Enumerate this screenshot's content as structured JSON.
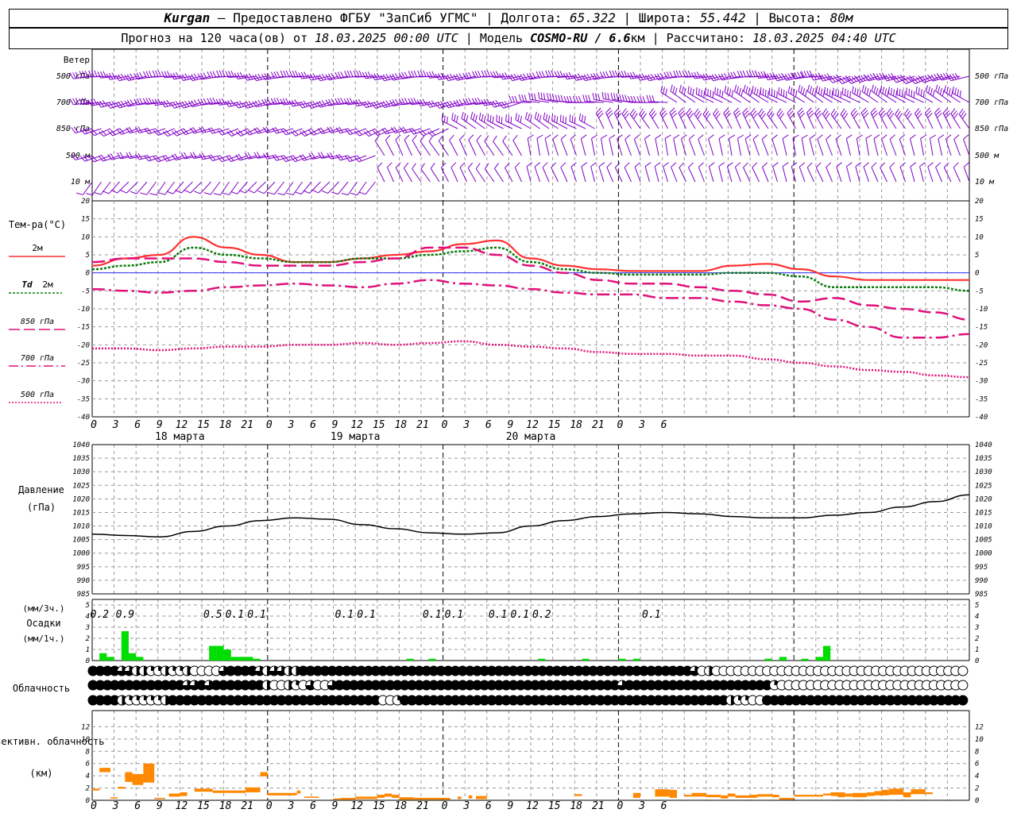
{
  "header": {
    "station": "Kurgan",
    "provider": " – Предоставлено ФГБУ \"ЗапСиб УГМС\" | Долгота: ",
    "lon": "65.322",
    "lat_label": " | Широта: ",
    "lat": "55.442",
    "alt_label": " | Высота: ",
    "alt": "80м",
    "fc_label": "Прогноз на 120 часа(ов) от ",
    "fc_time": "18.03.2025 00:00 UTC",
    "model_label": " | Модель ",
    "model": "COSMO-RU / 6.6",
    "model_unit": "км",
    "calc_label": " | Рассчитано: ",
    "calc_time": "18.03.2025 04:40 UTC"
  },
  "colors": {
    "wind": "#8000c8",
    "t2m": "#ff3030",
    "td2m": "#0a7a0a",
    "t850": "#e0107a",
    "t700": "#e0107a",
    "t500": "#e0107a",
    "zero": "#3030ff",
    "precip3": "#00dd00",
    "precip1": "#0000ff",
    "conv": "#ff8800",
    "grid": "#999999"
  },
  "time_axis": {
    "ticks": [
      "0",
      "3",
      "6",
      "9",
      "12",
      "15",
      "18",
      "21",
      "0",
      "3",
      "6",
      "9",
      "12",
      "15",
      "18",
      "21",
      "0",
      "3",
      "6",
      "9",
      "12",
      "15",
      "18",
      "21",
      "0",
      "3",
      "6"
    ],
    "days": [
      "18 марта",
      "19 марта",
      "20 марта"
    ]
  },
  "wind_panel": {
    "title": "Ветер",
    "levels": [
      "500 гПа",
      "700 гПа",
      "850 гПа",
      "500 м",
      "10 м"
    ]
  },
  "chart_data": [
    {
      "type": "line",
      "title": "Тем-ра(°C)",
      "ylim": [
        -40,
        20
      ],
      "yticks": [
        20,
        15,
        10,
        5,
        0,
        -5,
        -10,
        -15,
        -20,
        -25,
        -30,
        -35,
        -40
      ],
      "x_hours": [
        0,
        3,
        6,
        9,
        12,
        15,
        18,
        21,
        24,
        27,
        30,
        33,
        36,
        39,
        42,
        45,
        48,
        51,
        54,
        57,
        60,
        63,
        66,
        69,
        72,
        75,
        78
      ],
      "series": [
        {
          "name": "2м",
          "values": [
            2,
            4,
            5,
            10,
            7,
            5,
            3,
            3,
            4,
            5,
            6,
            8,
            9,
            4,
            2,
            1,
            0.5,
            0.5,
            0.5,
            2,
            2.5,
            1,
            -1,
            -2,
            -2,
            -2,
            -2
          ]
        },
        {
          "name": "Td 2м",
          "values": [
            1,
            2,
            3,
            7,
            5,
            4,
            3,
            3,
            4,
            4,
            5,
            6,
            7,
            3,
            1,
            0,
            -0.5,
            -0.5,
            -0.5,
            0,
            0,
            -1,
            -4,
            -4,
            -4,
            -4,
            -5
          ]
        },
        {
          "name": "850 гПа",
          "values": [
            3,
            4,
            4,
            4,
            3,
            2,
            2,
            2,
            3,
            4,
            7,
            7,
            5,
            2,
            0,
            -2,
            -3,
            -3,
            -4,
            -5,
            -6,
            -8,
            -7,
            -9,
            -10,
            -11,
            -13
          ]
        },
        {
          "name": "700 гПа",
          "values": [
            -4.5,
            -5,
            -5.5,
            -5,
            -4,
            -3.5,
            -3,
            -3.5,
            -4,
            -3,
            -2,
            -3,
            -3.5,
            -4.5,
            -5.5,
            -6,
            -6,
            -7,
            -7,
            -8,
            -9,
            -10,
            -13,
            -15,
            -18,
            -18,
            -17
          ]
        },
        {
          "name": "500 гПа",
          "values": [
            -21,
            -21,
            -21.5,
            -21,
            -20.5,
            -20.5,
            -20,
            -20,
            -19.5,
            -20,
            -19.5,
            -19,
            -20,
            -20.5,
            -21,
            -22,
            -22.5,
            -22.5,
            -23,
            -23,
            -24,
            -25,
            -26,
            -27,
            -27.5,
            -28.5,
            -29
          ]
        }
      ]
    },
    {
      "type": "line",
      "title": "Давление",
      "unit": "(гПа)",
      "ylim": [
        985,
        1040
      ],
      "yticks": [
        1040,
        1035,
        1030,
        1025,
        1020,
        1015,
        1010,
        1005,
        1000,
        995,
        990,
        985
      ],
      "x_hours": [
        0,
        3,
        6,
        9,
        12,
        15,
        18,
        21,
        24,
        27,
        30,
        33,
        36,
        39,
        42,
        45,
        48,
        51,
        54,
        57,
        60,
        63,
        66,
        69,
        72,
        75,
        78
      ],
      "values": [
        1007,
        1006.5,
        1006,
        1008,
        1010,
        1012,
        1013,
        1012.5,
        1010.5,
        1009,
        1007.5,
        1007,
        1007.5,
        1010,
        1012,
        1013.5,
        1014.5,
        1015,
        1014.5,
        1013.5,
        1013,
        1013,
        1014,
        1015,
        1017,
        1019,
        1021.5
      ]
    },
    {
      "type": "bar",
      "title": "Осадки",
      "units": [
        "(мм/3ч.)",
        "(мм/1ч.)"
      ],
      "ylim": [
        0,
        5
      ],
      "yticks": [
        5,
        4,
        3,
        2,
        1,
        0
      ],
      "hourly_mm": [
        0,
        0.2,
        0.1,
        0,
        0.8,
        0.2,
        0.1,
        0,
        0,
        0,
        0,
        0,
        0,
        0,
        0,
        0,
        0.4,
        0.4,
        0.3,
        0.1,
        0.1,
        0.1,
        0.05,
        0,
        0,
        0,
        0,
        0,
        0,
        0,
        0,
        0,
        0,
        0,
        0,
        0,
        0,
        0,
        0,
        0,
        0,
        0,
        0,
        0.05,
        0,
        0,
        0.05,
        0,
        0,
        0,
        0,
        0,
        0,
        0,
        0,
        0,
        0,
        0,
        0,
        0,
        0,
        0.05,
        0,
        0,
        0,
        0,
        0,
        0.05,
        0,
        0,
        0,
        0,
        0.05,
        0,
        0.05,
        0,
        0,
        0,
        0,
        0,
        0,
        0,
        0,
        0,
        0,
        0,
        0,
        0,
        0,
        0,
        0,
        0,
        0.05,
        0,
        0.1,
        0,
        0,
        0.05,
        0,
        0.1,
        0.4,
        0,
        0,
        0,
        0,
        0,
        0,
        0,
        0,
        0,
        0,
        0,
        0,
        0,
        0,
        0,
        0,
        0,
        0
      ],
      "labels": [
        {
          "h": 1,
          "text": "0.2"
        },
        {
          "h": 4.5,
          "text": "0.9"
        },
        {
          "h": 16.5,
          "text": "0.5"
        },
        {
          "h": 19.5,
          "text": "0.1"
        },
        {
          "h": 22.5,
          "text": "0.1"
        },
        {
          "h": 34.5,
          "text": "0.1"
        },
        {
          "h": 37.5,
          "text": "0.1"
        },
        {
          "h": 46.5,
          "text": "0.1"
        },
        {
          "h": 49.5,
          "text": "0.1"
        },
        {
          "h": 55.5,
          "text": "0.1"
        },
        {
          "h": 58.5,
          "text": "0.1"
        },
        {
          "h": 61.5,
          "text": "0.2"
        },
        {
          "h": 76.5,
          "text": "0.1"
        }
      ]
    },
    {
      "type": "table",
      "title": "Облачность",
      "rows_note": "high / middle / low cloud cover, octas per hour",
      "high": [
        8,
        8,
        8,
        8,
        6,
        6,
        4,
        4,
        2,
        2,
        4,
        2,
        2,
        4,
        0,
        0,
        0,
        0,
        6,
        8,
        8,
        8,
        8,
        6,
        4,
        6,
        6,
        4,
        4,
        8,
        8,
        8,
        8,
        8,
        8,
        8,
        8,
        8,
        8,
        8,
        8,
        8,
        8,
        8,
        8,
        8,
        8,
        8,
        8,
        8,
        8,
        8,
        8,
        8,
        8,
        8,
        8,
        8,
        8,
        8,
        8,
        8,
        8,
        8,
        8,
        8,
        8,
        8,
        8,
        8,
        8,
        8,
        8,
        8,
        8,
        8,
        8,
        8,
        8,
        8,
        8,
        8,
        8,
        6,
        0,
        4,
        0,
        0,
        0,
        0,
        0,
        0,
        0,
        0,
        0,
        0,
        0,
        0,
        0,
        0,
        0,
        0,
        0,
        0,
        0,
        0,
        0,
        0,
        0,
        0,
        0,
        0,
        0,
        0,
        0,
        0,
        0,
        0,
        0,
        0,
        0
      ],
      "middle": [
        8,
        8,
        8,
        8,
        8,
        8,
        8,
        8,
        8,
        8,
        8,
        8,
        8,
        6,
        6,
        8,
        6,
        8,
        8,
        8,
        8,
        8,
        8,
        8,
        4,
        0,
        0,
        4,
        2,
        0,
        6,
        0,
        0,
        6,
        8,
        8,
        8,
        8,
        8,
        8,
        8,
        8,
        8,
        8,
        8,
        8,
        8,
        8,
        8,
        8,
        8,
        8,
        8,
        8,
        8,
        8,
        8,
        8,
        8,
        8,
        8,
        8,
        8,
        8,
        8,
        8,
        8,
        8,
        8,
        8,
        8,
        8,
        8,
        6,
        8,
        8,
        8,
        8,
        8,
        8,
        8,
        8,
        8,
        8,
        8,
        8,
        8,
        8,
        8,
        8,
        8,
        8,
        8,
        8,
        2,
        0,
        0,
        0,
        0,
        0,
        0,
        0,
        0,
        0,
        0,
        0,
        0,
        0,
        0,
        0,
        0,
        0,
        0,
        0,
        0,
        0,
        0,
        0,
        0,
        0,
        0
      ],
      "low": [
        8,
        8,
        8,
        8,
        4,
        2,
        2,
        2,
        2,
        2,
        4,
        8,
        8,
        8,
        8,
        8,
        8,
        8,
        8,
        8,
        8,
        8,
        8,
        8,
        8,
        8,
        8,
        8,
        8,
        8,
        8,
        8,
        8,
        8,
        8,
        8,
        8,
        8,
        8,
        8,
        0,
        0,
        2,
        8,
        8,
        8,
        8,
        8,
        8,
        8,
        8,
        8,
        8,
        8,
        8,
        8,
        8,
        8,
        8,
        8,
        8,
        8,
        8,
        8,
        8,
        8,
        8,
        8,
        8,
        8,
        8,
        8,
        8,
        8,
        8,
        8,
        8,
        8,
        8,
        8,
        8,
        8,
        8,
        8,
        8,
        8,
        8,
        8,
        4,
        2,
        2,
        0,
        0,
        8,
        8,
        8,
        8,
        8,
        8,
        8,
        8,
        8,
        8,
        8,
        8,
        8,
        8,
        8,
        8,
        8,
        8,
        8,
        8,
        8,
        8,
        8,
        8,
        8,
        8,
        8,
        8
      ]
    },
    {
      "type": "bar",
      "title": "Конвективн. облачность",
      "unit": "(км)",
      "ylim": [
        0,
        14
      ],
      "yticks": [
        12,
        10,
        8,
        6,
        4,
        2,
        0
      ],
      "segments": [
        {
          "h0": 0,
          "h1": 1,
          "base": 1.6,
          "top": 1.9
        },
        {
          "h0": 1,
          "h1": 2.5,
          "base": 4.6,
          "top": 5.3
        },
        {
          "h0": 2.5,
          "h1": 3.5,
          "base": 0.3,
          "top": 0.5
        },
        {
          "h0": 3.5,
          "h1": 4.5,
          "base": 1.9,
          "top": 2.2
        },
        {
          "h0": 4.5,
          "h1": 5.5,
          "base": 3.0,
          "top": 4.6
        },
        {
          "h0": 5.5,
          "h1": 7,
          "base": 2.5,
          "top": 4.3
        },
        {
          "h0": 7,
          "h1": 8.5,
          "base": 2.9,
          "top": 6.0
        },
        {
          "h0": 8.5,
          "h1": 10,
          "base": 0.2,
          "top": 0.4
        },
        {
          "h0": 10.5,
          "h1": 12,
          "base": 0.6,
          "top": 1.1
        },
        {
          "h0": 12,
          "h1": 13,
          "base": 0.7,
          "top": 1.3
        },
        {
          "h0": 14,
          "h1": 16.5,
          "base": 1.4,
          "top": 1.9
        },
        {
          "h0": 16.5,
          "h1": 21,
          "base": 1.2,
          "top": 1.6
        },
        {
          "h0": 21,
          "h1": 23,
          "base": 1.3,
          "top": 2.1
        },
        {
          "h0": 23,
          "h1": 24,
          "base": 3.9,
          "top": 4.6
        },
        {
          "h0": 24,
          "h1": 28,
          "base": 0.8,
          "top": 1.2
        },
        {
          "h0": 28,
          "h1": 28.5,
          "base": 1.1,
          "top": 1.6
        },
        {
          "h0": 29,
          "h1": 31,
          "base": 0.4,
          "top": 0.6
        },
        {
          "h0": 33,
          "h1": 34,
          "base": 0.1,
          "top": 0.3
        },
        {
          "h0": 34,
          "h1": 36,
          "base": 0.1,
          "top": 0.4
        },
        {
          "h0": 36,
          "h1": 39,
          "base": 0.2,
          "top": 0.6
        },
        {
          "h0": 39,
          "h1": 40,
          "base": 0.4,
          "top": 0.9
        },
        {
          "h0": 40,
          "h1": 41,
          "base": 0.6,
          "top": 1.1
        },
        {
          "h0": 41,
          "h1": 42,
          "base": 0.4,
          "top": 0.9
        },
        {
          "h0": 42,
          "h1": 44,
          "base": 0.1,
          "top": 0.5
        },
        {
          "h0": 44,
          "h1": 49,
          "base": 0.1,
          "top": 0.4
        },
        {
          "h0": 50,
          "h1": 50.5,
          "base": 0.2,
          "top": 0.6
        },
        {
          "h0": 51.5,
          "h1": 52,
          "base": 0.3,
          "top": 0.8
        },
        {
          "h0": 52.5,
          "h1": 54,
          "base": 0.2,
          "top": 0.7
        },
        {
          "h0": 66,
          "h1": 67,
          "base": 0.7,
          "top": 1.0
        },
        {
          "h0": 74,
          "h1": 75,
          "base": 0.4,
          "top": 1.2
        },
        {
          "h0": 77,
          "h1": 79,
          "base": 0.6,
          "top": 1.8
        },
        {
          "h0": 79,
          "h1": 80,
          "base": 0.4,
          "top": 1.7
        },
        {
          "h0": 81,
          "h1": 82,
          "base": 0.6,
          "top": 0.9
        },
        {
          "h0": 82,
          "h1": 84,
          "base": 0.6,
          "top": 1.2
        },
        {
          "h0": 84,
          "h1": 86,
          "base": 0.5,
          "top": 0.9
        },
        {
          "h0": 86,
          "h1": 87,
          "base": 0.3,
          "top": 0.8
        },
        {
          "h0": 87,
          "h1": 88,
          "base": 0.6,
          "top": 1.1
        },
        {
          "h0": 88,
          "h1": 90,
          "base": 0.4,
          "top": 0.8
        },
        {
          "h0": 90,
          "h1": 91,
          "base": 0.4,
          "top": 0.9
        },
        {
          "h0": 91,
          "h1": 93,
          "base": 0.6,
          "top": 1.0
        },
        {
          "h0": 93,
          "h1": 94,
          "base": 0.5,
          "top": 0.9
        },
        {
          "h0": 94,
          "h1": 96,
          "base": 0.1,
          "top": 0.4
        },
        {
          "h0": 96,
          "h1": 98,
          "base": 0.6,
          "top": 0.9
        },
        {
          "h0": 98,
          "h1": 100,
          "base": 0.6,
          "top": 0.9
        },
        {
          "h0": 100,
          "h1": 101,
          "base": 0.8,
          "top": 1.1
        },
        {
          "h0": 101,
          "h1": 102,
          "base": 0.7,
          "top": 1.3
        },
        {
          "h0": 102,
          "h1": 103,
          "base": 0.5,
          "top": 1.3
        },
        {
          "h0": 103,
          "h1": 104,
          "base": 0.6,
          "top": 1.1
        },
        {
          "h0": 104,
          "h1": 106,
          "base": 0.5,
          "top": 1.2
        },
        {
          "h0": 106,
          "h1": 107,
          "base": 0.7,
          "top": 1.3
        },
        {
          "h0": 107,
          "h1": 108,
          "base": 0.8,
          "top": 1.5
        },
        {
          "h0": 108,
          "h1": 109,
          "base": 0.8,
          "top": 1.7
        },
        {
          "h0": 109,
          "h1": 111,
          "base": 0.9,
          "top": 1.9
        },
        {
          "h0": 111,
          "h1": 112,
          "base": 0.5,
          "top": 1.3
        },
        {
          "h0": 112,
          "h1": 114,
          "base": 1.0,
          "top": 1.8
        },
        {
          "h0": 114,
          "h1": 115,
          "base": 1.0,
          "top": 1.3
        }
      ]
    }
  ],
  "legend": {
    "t2m": "2м",
    "td_label": "Td",
    "td_level": "2м",
    "l850": "850 гПа",
    "l700": "700 гПа",
    "l500": "500 гПа"
  }
}
